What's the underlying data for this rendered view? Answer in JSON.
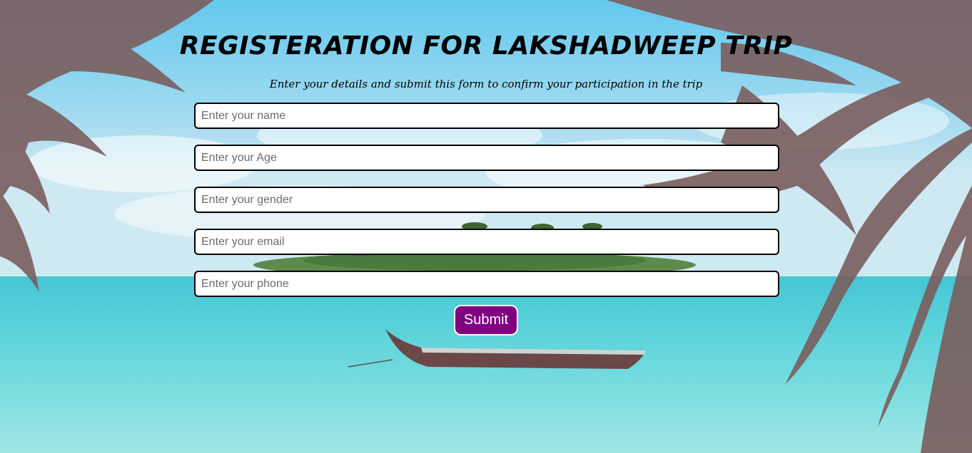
{
  "header": {
    "title": "REGISTERATION FOR LAKSHADWEEP TRIP",
    "subtitle": "Enter your details and submit this form to confirm your participation in the trip"
  },
  "form": {
    "fields": [
      {
        "placeholder": "Enter your name",
        "value": ""
      },
      {
        "placeholder": "Enter your Age",
        "value": ""
      },
      {
        "placeholder": "Enter your gender",
        "value": ""
      },
      {
        "placeholder": "Enter your email",
        "value": ""
      },
      {
        "placeholder": "Enter your phone",
        "value": ""
      }
    ],
    "submit_label": "Submit"
  },
  "colors": {
    "accent": "#800080",
    "sky": "#6fcbe8",
    "sea": "#5fd3d8",
    "palm": "#7a5e5e"
  },
  "background": {
    "image": "beach-island-boat-palms"
  }
}
